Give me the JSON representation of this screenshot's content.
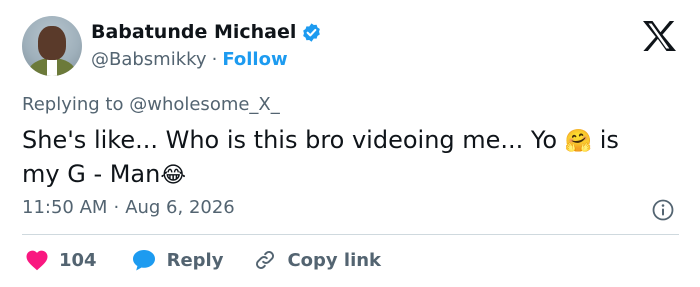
{
  "author": {
    "name": "Babatunde Michael",
    "handle": "@Babsmikky",
    "separator": "·",
    "follow_label": "Follow"
  },
  "replying": {
    "prefix": "Replying to",
    "mention": "@wholesome_X_"
  },
  "tweet": {
    "line1_text": "She's like... Who is this bro videoing me... Yo",
    "line1_emoji": "🤗",
    "line1_end": "is",
    "line2_text": "my G - Man",
    "line2_emoji": "😂"
  },
  "meta": {
    "time": "11:50 AM",
    "separator": "·",
    "date": "Aug 6, 2026"
  },
  "actions": {
    "like_count": "104",
    "reply_label": "Reply",
    "copy_label": "Copy link"
  },
  "icons": {
    "verified": "verified-badge-icon",
    "x_logo": "x-logo-icon",
    "info": "info-icon",
    "heart": "heart-icon",
    "reply": "reply-bubble-icon",
    "link": "link-icon"
  },
  "colors": {
    "accent": "#1d9bf0",
    "heart": "#f91880",
    "muted": "#536471",
    "text": "#0f1419"
  }
}
